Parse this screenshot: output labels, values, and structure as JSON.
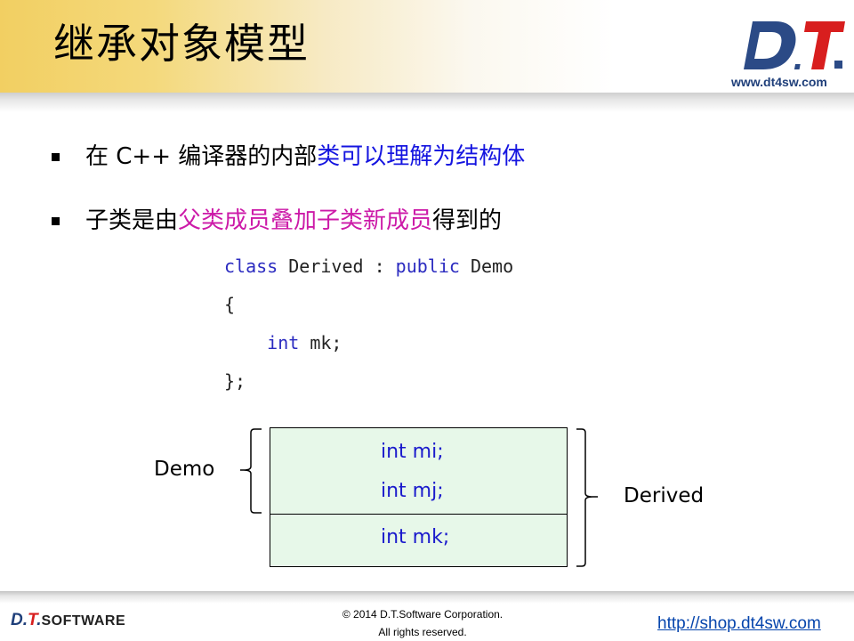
{
  "slide": {
    "title": "继承对象模型",
    "logo": {
      "mark_d": "D",
      "mark_t": "T",
      "url": "www.dt4sw.com"
    },
    "bullets": [
      {
        "prefix": "在 C++ 编译器的内部",
        "highlight": "类可以理解为结构体",
        "suffix": "",
        "highlight_color": "#1515e0"
      },
      {
        "prefix": "子类是由",
        "highlight": "父类成员叠加子类新成员",
        "suffix": "得到的",
        "highlight_color": "#cc1aa8"
      }
    ],
    "code": {
      "line1_kw1": "class",
      "line1_mid": " Derived : ",
      "line1_kw2": "public",
      "line1_end": " Demo",
      "line2": "{",
      "line3_indent": "    ",
      "line3_kw": "int",
      "line3_rest": " mk;",
      "line4": "};"
    },
    "diagram": {
      "fields": [
        "int mi;",
        "int mj;",
        "int mk;"
      ],
      "left_label": "Demo",
      "right_label": "Derived",
      "fill_color": "#e7f8e9"
    },
    "footer": {
      "logo_text_d": "D.",
      "logo_text_t": "T",
      "logo_text_dot": ".",
      "logo_text_sw": "SOFTWARE",
      "copyright_line1": "© 2014 D.T.Software Corporation.",
      "copyright_line2": "All rights reserved.",
      "url": "http://shop.dt4sw.com"
    }
  }
}
